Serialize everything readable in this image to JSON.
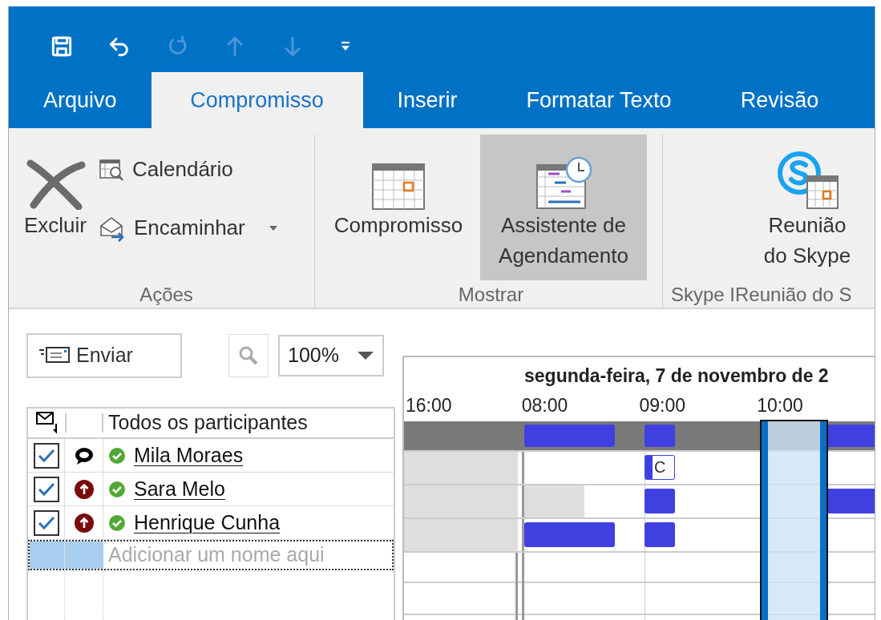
{
  "quick_access": [
    {
      "kind": "save",
      "disabled": false
    },
    {
      "kind": "undo",
      "disabled": false
    },
    {
      "kind": "redo",
      "disabled": true
    },
    {
      "kind": "up",
      "disabled": true
    },
    {
      "kind": "down",
      "disabled": true
    },
    {
      "kind": "customize",
      "disabled": false
    }
  ],
  "tabs": [
    {
      "label": "Arquivo",
      "selected": false
    },
    {
      "label": "Compromisso",
      "selected": true
    },
    {
      "label": "Inserir",
      "selected": false
    },
    {
      "label": "Formatar Texto",
      "selected": false
    },
    {
      "label": "Revisão",
      "selected": false
    }
  ],
  "ribbon": {
    "groups": [
      {
        "label": "Ações",
        "buttons": [
          {
            "kind": "delete",
            "label": "Excluir",
            "selected": false
          },
          {
            "kind": "calendar-search",
            "label": "Calendário",
            "selected": false
          },
          {
            "kind": "forward",
            "label": "Encaminhar",
            "selected": false,
            "dropdown": true
          }
        ]
      },
      {
        "label": "Mostrar",
        "buttons": [
          {
            "kind": "calendar",
            "label": "Compromisso",
            "selected": false
          },
          {
            "kind": "scheduling",
            "label": "Assistente de Agendamento",
            "selected": true
          }
        ]
      },
      {
        "label": "Skype IReunião do S",
        "buttons": [
          {
            "kind": "skype",
            "label": "Reunião do Skype",
            "selected": false
          }
        ]
      }
    ]
  },
  "toolbar": {
    "send_label": "Enviar",
    "zoom": "100%"
  },
  "participants": {
    "header": "Todos os participantes",
    "placeholder": "Adicionar um nome aqui",
    "rows": [
      {
        "name": "Mila Moraes",
        "checked": true,
        "organizer": true,
        "accepted": true
      },
      {
        "name": "Sara Melo",
        "checked": true,
        "organizer": false,
        "accepted": true
      },
      {
        "name": "Henrique Cunha",
        "checked": true,
        "organizer": false,
        "accepted": true
      }
    ]
  },
  "timeline": {
    "day": "segunda-feira, 7 de novembro de 2",
    "hours": [
      "16:00",
      "08:00",
      "09:00",
      "10:00"
    ],
    "event_label": "C"
  }
}
